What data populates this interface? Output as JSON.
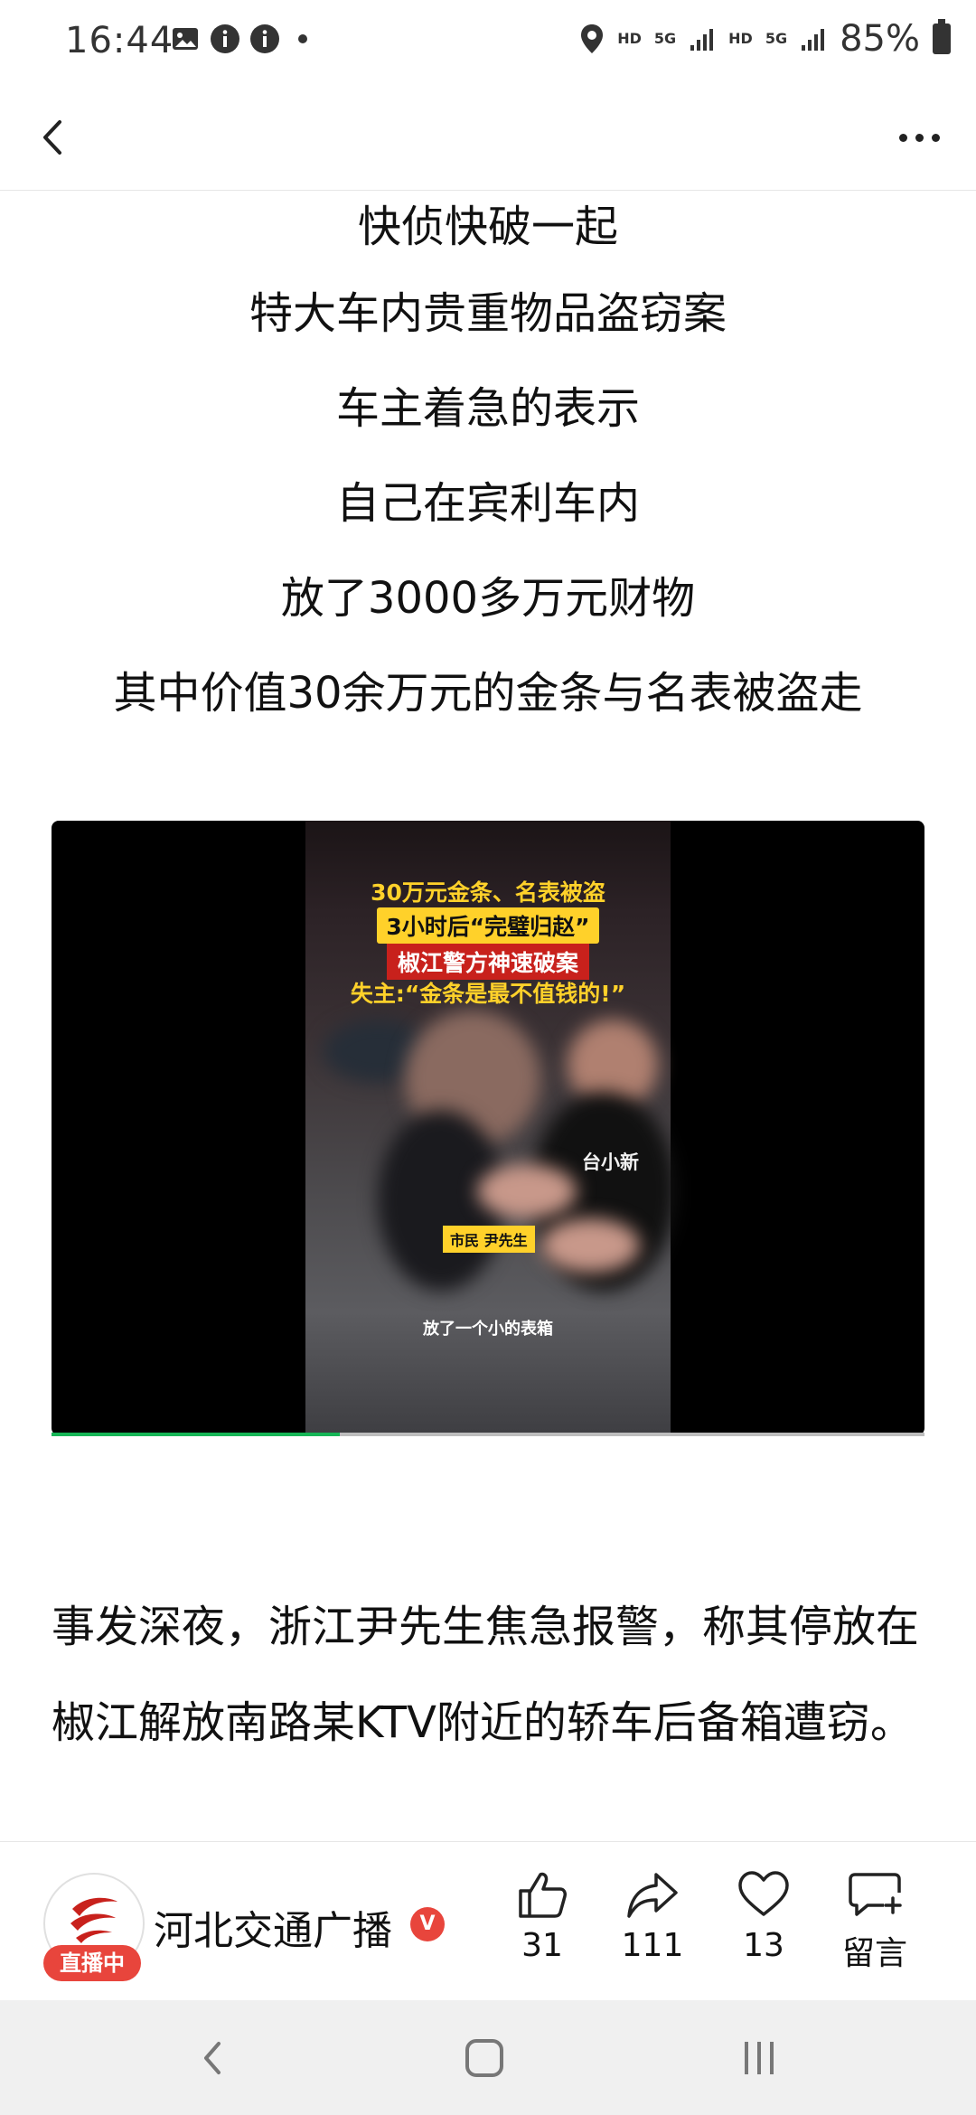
{
  "status_bar": {
    "time": "16:44",
    "hd_label_1": "HD",
    "net_label_1": "5G",
    "hd_label_2": "HD",
    "net_label_2": "5G",
    "battery": "85%"
  },
  "article": {
    "lines": [
      "快侦快破一起",
      "特大车内贵重物品盗窃案",
      "车主着急的表示",
      "自己在宾利车内",
      "放了3000多万元财物",
      "其中价值30余万元的金条与名表被盗走"
    ],
    "video": {
      "overlay_line_1": "30万元金条、名表被盗",
      "overlay_line_2": "3小时后“完璧归赵”",
      "overlay_line_3": "椒江警方神速破案",
      "overlay_line_4": "失主:“金条是最不值钱的!”",
      "person_tag": "市民 尹先生",
      "watermark": "台小新",
      "subtitle": "放了一个小的表箱",
      "progress": 0.33
    },
    "paragraph": "事发深夜，浙江尹先生焦急报警，称其停放在椒江解放南路某KTV附近的轿车后备箱遭窃。"
  },
  "footer": {
    "account_name": "河北交通广播",
    "live_badge": "直播中",
    "verified_mark": "V",
    "likes": "31",
    "shares": "111",
    "favorites": "13",
    "comment_label": "留言"
  },
  "colors": {
    "accent_red": "#e8453c",
    "progress_green": "#16b556",
    "overlay_yellow": "#ffd12a"
  }
}
